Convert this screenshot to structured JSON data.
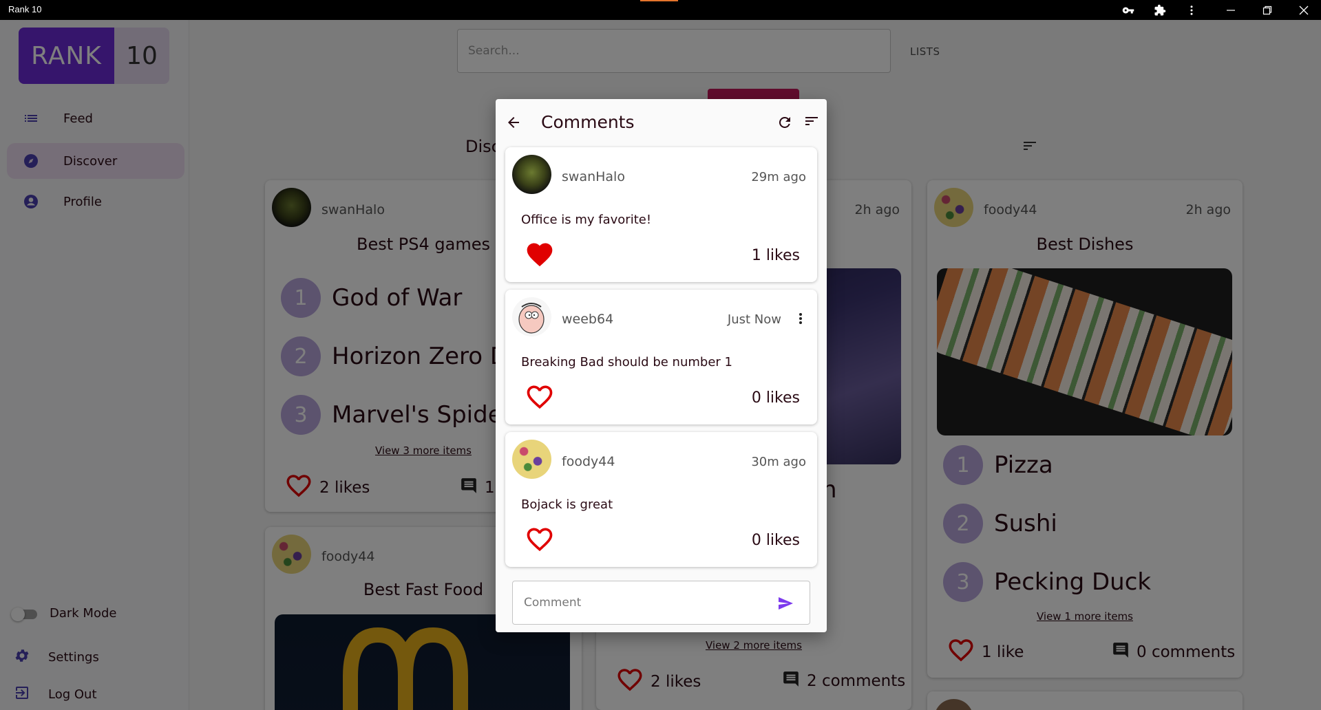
{
  "window": {
    "title": "Rank 10"
  },
  "logo": {
    "rank": "RANK",
    "ten": "10"
  },
  "sidebar": {
    "items": [
      {
        "label": "Feed",
        "icon": "list-icon"
      },
      {
        "label": "Discover",
        "icon": "compass-icon"
      },
      {
        "label": "Profile",
        "icon": "person-icon"
      }
    ],
    "dark_mode_label": "Dark Mode",
    "settings_label": "Settings",
    "logout_label": "Log Out"
  },
  "header": {
    "search_placeholder": "Search...",
    "lists_label": "LISTS",
    "section_label": "Disc"
  },
  "cards": {
    "c1": {
      "user": "swanHalo",
      "title": "Best PS4 games",
      "items": [
        "God of War",
        "Horizon Zero Da",
        "Marvel's Spider-"
      ],
      "nums": [
        "1",
        "2",
        "3"
      ],
      "more": "View 3 more items",
      "likes": "2 likes",
      "comments": "1"
    },
    "c2": {
      "time": "2h ago",
      "more": "View 2 more items",
      "likes": "2 likes",
      "comments": "2 comments",
      "partial": "n"
    },
    "c3": {
      "user": "foody44",
      "time": "2h ago",
      "title": "Best Dishes",
      "items": [
        "Pizza",
        "Sushi",
        "Pecking Duck"
      ],
      "nums": [
        "1",
        "2",
        "3"
      ],
      "more": "View 1 more items",
      "likes": "1 like",
      "comments": "0 comments"
    },
    "c4": {
      "user": "foody44",
      "title": "Best Fast Food"
    }
  },
  "modal": {
    "title": "Comments",
    "comments": [
      {
        "user": "swanHalo",
        "time": "29m ago",
        "text": "Office is my favorite!",
        "likes": "1 likes",
        "liked": true
      },
      {
        "user": "weeb64",
        "time": "Just Now",
        "text": "Breaking Bad should be number 1",
        "likes": "0 likes",
        "liked": false
      },
      {
        "user": "foody44",
        "time": "30m ago",
        "text": "Bojack is great",
        "likes": "0 likes",
        "liked": false
      }
    ],
    "input_placeholder": "Comment"
  },
  "colors": {
    "brand": "#6c2bd9",
    "heart": "#e00000",
    "rank_circle": "#b8a6dc",
    "send": "#7c3aed"
  }
}
